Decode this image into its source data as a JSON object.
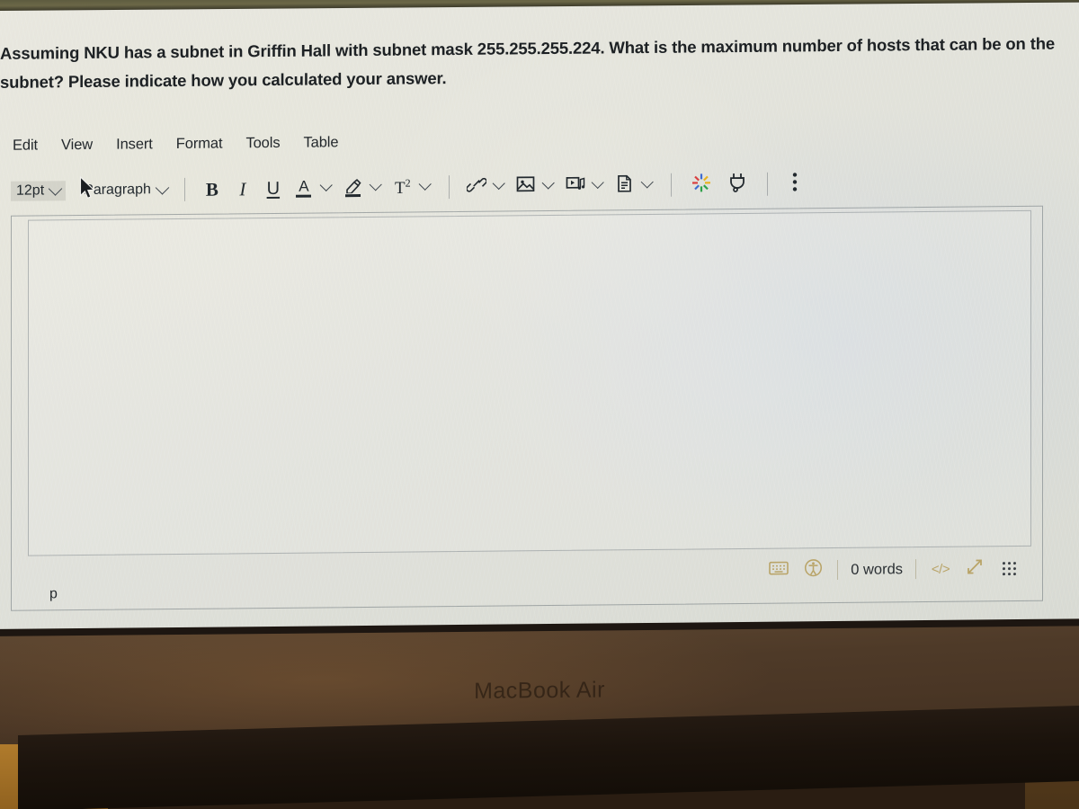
{
  "device": {
    "brand_label": "MacBook Air"
  },
  "question": {
    "text": "Assuming NKU has a subnet in Griffin Hall with subnet mask 255.255.255.224. What is the maximum number of hosts that can be on the subnet? Please indicate how you calculated your answer."
  },
  "editor": {
    "menubar": [
      {
        "label": "Edit",
        "name": "menu-edit"
      },
      {
        "label": "View",
        "name": "menu-view"
      },
      {
        "label": "Insert",
        "name": "menu-insert"
      },
      {
        "label": "Format",
        "name": "menu-format"
      },
      {
        "label": "Tools",
        "name": "menu-tools"
      },
      {
        "label": "Table",
        "name": "menu-table"
      }
    ],
    "toolbar": {
      "font_size": "12pt",
      "block_format": "Paragraph",
      "bold_label": "B",
      "italic_label": "I",
      "underline_label": "U",
      "text_color_label": "A",
      "highlight_icon": "highlighter-pen-icon",
      "superscript_label": "T",
      "superscript_exponent": "2",
      "link_icon": "link-icon",
      "image_icon": "image-icon",
      "media_icon": "media-icon",
      "document_icon": "document-icon",
      "apps_icon": "apps-sparkle-icon",
      "plugin_icon": "plug-icon",
      "overflow_icon": "kebab-menu-icon"
    },
    "content": {
      "body_text": "",
      "element_path": "p"
    },
    "statusbar": {
      "keyboard_shortcuts_icon": "keyboard-icon",
      "accessibility_icon": "accessibility-checker-icon",
      "word_count": "0 words",
      "html_editor_label": "</>",
      "fullscreen_icon": "expand-arrows-icon",
      "resize_handle_icon": "resize-grip-icon"
    }
  },
  "colors": {
    "screen_bg": "#e4e4dc",
    "text": "#1d2124",
    "toolbar_icon": "#232a2f",
    "status_accent": "#b9a468",
    "bezel": "#4a3625",
    "hinge": "#1b130c"
  }
}
